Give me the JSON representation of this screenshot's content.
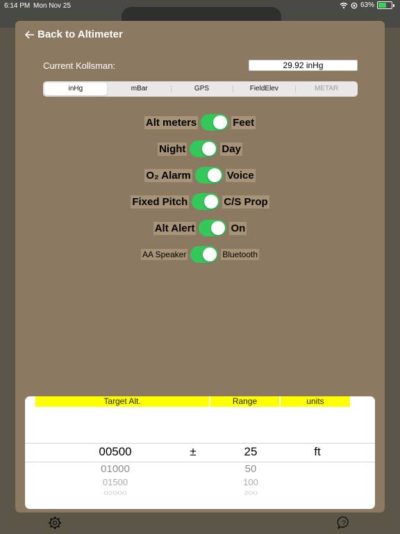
{
  "status_bar": {
    "time": "6:14 PM",
    "date": "Mon Nov 25",
    "battery": "63%",
    "battery_level": 0.63
  },
  "header": {
    "back_label": "Back to Altimeter",
    "back_icon": "arrow-left-icon"
  },
  "kollsman": {
    "label": "Current Kollsman:",
    "value": "29.92 inHg"
  },
  "segments": [
    {
      "label": "inHg",
      "selected": true
    },
    {
      "label": "mBar"
    },
    {
      "label": "GPS"
    },
    {
      "label": "FieldElev"
    },
    {
      "label": "METAR",
      "disabled": true
    }
  ],
  "toggles": [
    {
      "left": "Alt meters",
      "right": "Feet",
      "on": true
    },
    {
      "left": "Night",
      "right": "Day",
      "on": true
    },
    {
      "left": "O₂ Alarm",
      "right": "Voice",
      "on": true
    },
    {
      "left": "Fixed Pitch",
      "right": "C/S Prop",
      "on": true
    },
    {
      "left": "Alt Alert",
      "right": "On",
      "on": true
    },
    {
      "left": "AA Speaker",
      "right": "Bluetooth",
      "on": true
    }
  ],
  "picker": {
    "headers": {
      "target": "Target Alt.",
      "range": "Range",
      "units": "units"
    },
    "target_values": [
      "00500",
      "01000",
      "01500",
      "02000"
    ],
    "separator": "±",
    "range_values": [
      "25",
      "50",
      "100",
      "200"
    ],
    "units_value": "ft"
  },
  "footer": {
    "settings_icon": "gear-icon",
    "help_icon": "help-icon"
  },
  "colors": {
    "panel": "#8b7962",
    "toggle_on": "#34c759",
    "header_highlight": "#ffff00"
  }
}
